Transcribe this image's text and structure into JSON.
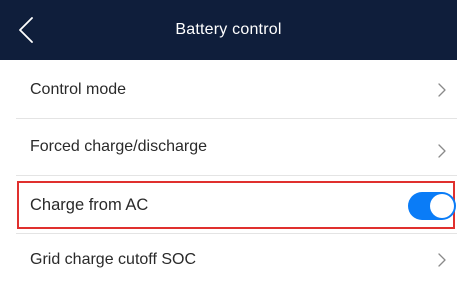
{
  "header": {
    "title": "Battery control",
    "back_icon": "chevron-left-icon"
  },
  "rows": [
    {
      "label": "Control mode",
      "control": "chevron-right-icon"
    },
    {
      "label": "Forced charge/discharge",
      "control": "chevron-right-icon"
    },
    {
      "label": "Charge from AC",
      "control": "toggle",
      "toggle_on": true
    },
    {
      "label": "Grid charge cutoff SOC",
      "control": "chevron-right-icon"
    }
  ],
  "colors": {
    "header_bg": "#0f1e3b",
    "toggle_on": "#0a7cf7",
    "highlight_border": "#e0302e"
  }
}
